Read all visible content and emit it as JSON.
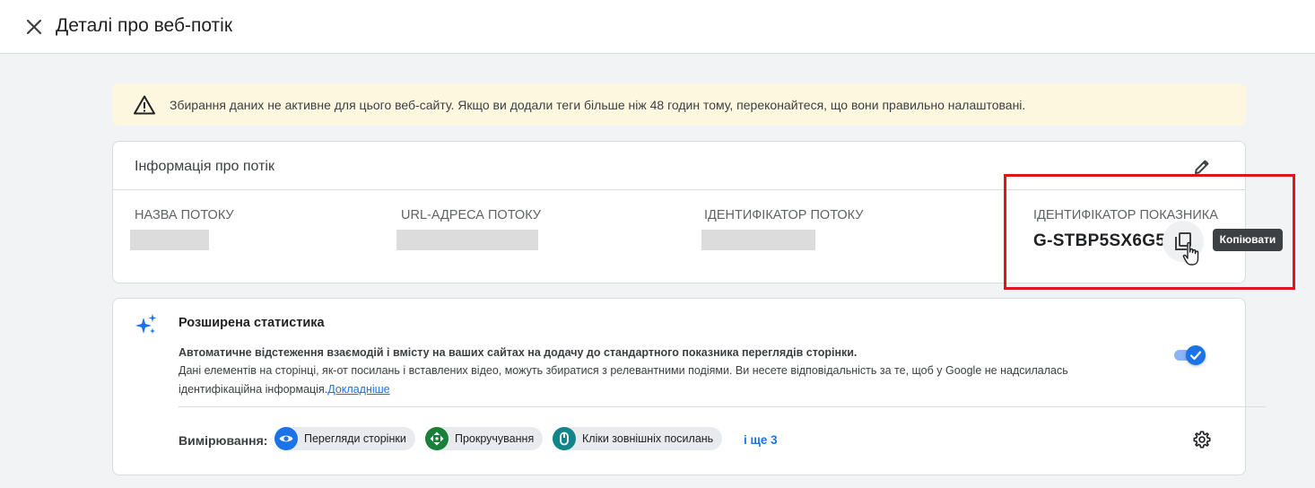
{
  "header": {
    "title": "Деталі про веб-потік"
  },
  "alert": {
    "text": "Збирання даних не активне для цього веб-сайту. Якщо ви додали теги більше ніж 48 годин тому, переконайтеся, що вони правильно налаштовані."
  },
  "stream_info": {
    "title": "Інформація про потік",
    "fields": [
      {
        "label": "НАЗВА ПОТОКУ"
      },
      {
        "label": "URL-АДРЕСА ПОТОКУ"
      },
      {
        "label": "ІДЕНТИФІКАТОР ПОТОКУ"
      },
      {
        "label": "ІДЕНТИФІКАТОР ПОКАЗНИКА",
        "value": "G-STBP5SX6G5"
      }
    ],
    "copy_tooltip": "Копіювати"
  },
  "enhanced": {
    "title": "Розширена статистика",
    "bold_text": "Автоматичне відстеження взаємодій і вмісту на ваших сайтах на додачу до стандартного показника переглядів сторінки.",
    "desc_text": "Дані елементів на сторінці, як-от посилань і вставлених відео, можуть збиратися з релевантними подіями. Ви несете відповідальність за те, щоб у Google не надсилалась ідентифікаційна інформація.",
    "learn_more": "Докладніше",
    "toggle_on": true,
    "measurements_label": "Вимірювання:",
    "chips": [
      {
        "label": "Перегляди сторінки",
        "icon": "eye-icon",
        "color": "#1a73e8"
      },
      {
        "label": "Прокручування",
        "icon": "scroll-arrows-icon",
        "color": "#188038"
      },
      {
        "label": "Кліки зовнішніх посилань",
        "icon": "mouse-icon",
        "color": "#12858a"
      }
    ],
    "more": "і ще 3"
  }
}
